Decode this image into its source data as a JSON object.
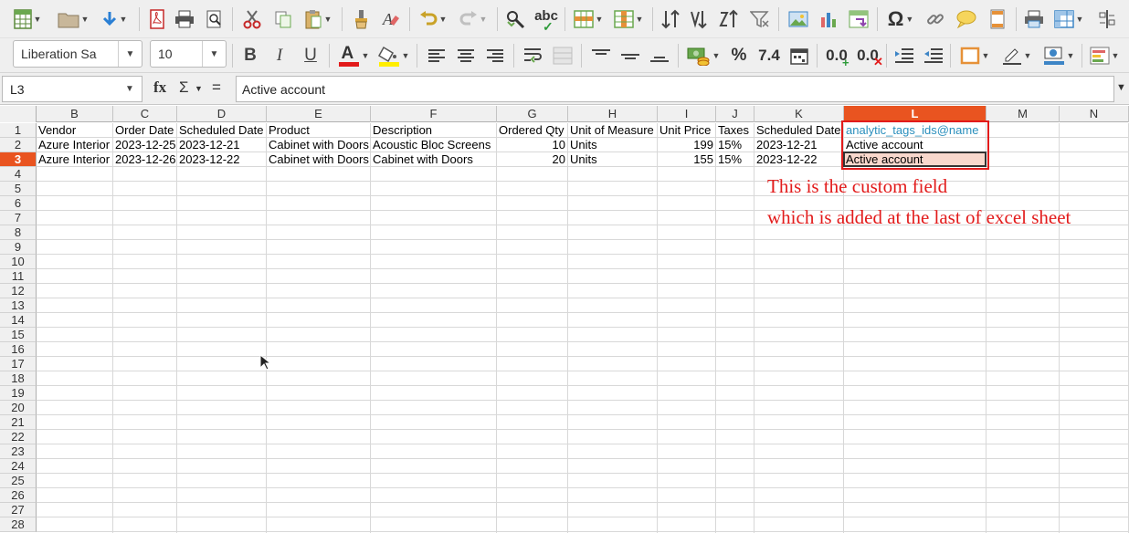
{
  "toolbar1": {
    "buttons": [
      "new",
      "open",
      "save",
      "export-pdf",
      "print",
      "print-preview",
      "cut",
      "copy",
      "paste",
      "clone-formatting",
      "clear-formatting",
      "undo",
      "redo",
      "find-replace",
      "spelling",
      "row",
      "column",
      "sort",
      "sort-ascending",
      "sort-descending",
      "autofilter",
      "image",
      "chart",
      "pivot-table",
      "special-character",
      "hyperlink",
      "comment",
      "header-footer",
      "define-print-area",
      "freeze-rows-columns",
      "split-window"
    ],
    "omega": "Ω",
    "spelling_text": "abc"
  },
  "toolbar2": {
    "font_name": "Liberation Sa",
    "font_size": "10",
    "bold": "B",
    "italic": "I",
    "underline": "U",
    "font_color": "A",
    "percent": "%",
    "number_format": "7.4",
    "add_decimal": "0.0",
    "delete_decimal": "0.0",
    "accent_color": "#e21b1b",
    "highlight_color": "#ffee00"
  },
  "formula_bar": {
    "cell_ref": "L3",
    "fx": "fx",
    "sum": "Σ",
    "equals": "=",
    "content": "Active account"
  },
  "columns": [
    {
      "label": "",
      "key": "A"
    },
    {
      "label": "B"
    },
    {
      "label": "C"
    },
    {
      "label": "D"
    },
    {
      "label": "E"
    },
    {
      "label": "F"
    },
    {
      "label": "G"
    },
    {
      "label": "H"
    },
    {
      "label": "I"
    },
    {
      "label": "J"
    },
    {
      "label": "K"
    },
    {
      "label": "L"
    },
    {
      "label": "M"
    },
    {
      "label": "N"
    }
  ],
  "selected_column": "L",
  "selected_row": "3",
  "rows": [
    "1",
    "2",
    "3",
    "4",
    "5",
    "6",
    "7",
    "8",
    "9",
    "10",
    "11",
    "12",
    "13",
    "14",
    "15",
    "16",
    "17",
    "18",
    "19",
    "20",
    "21",
    "22",
    "23",
    "24",
    "25",
    "26",
    "27",
    "28"
  ],
  "table": {
    "headers": [
      "Vendor",
      "Order Date",
      "Scheduled Date",
      "Product",
      "Description",
      "Ordered Qty",
      "Unit of Measure",
      "Unit Price",
      "Taxes",
      "Scheduled Date",
      "analytic_tags_ids@name"
    ],
    "data": [
      [
        "Azure Interior",
        "2023-12-25",
        "2023-12-21",
        "Cabinet with Doors",
        "Acoustic Bloc Screens",
        "10",
        "Units",
        "199",
        "15%",
        "2023-12-21",
        "Active account"
      ],
      [
        "Azure Interior",
        "2023-12-26",
        "2023-12-22",
        "Cabinet with Doors",
        "Cabinet with Doors",
        "20",
        "Units",
        "155",
        "15%",
        "2023-12-22",
        "Active account"
      ]
    ]
  },
  "annotation": {
    "line1": "This is the custom field",
    "line2": "which is added at the last of excel sheet",
    "color": "#e21b1b"
  },
  "colors": {
    "selection_header": "#e95420",
    "active_cell_fill": "#f8d7cc",
    "header_link": "#2a8fbd"
  }
}
